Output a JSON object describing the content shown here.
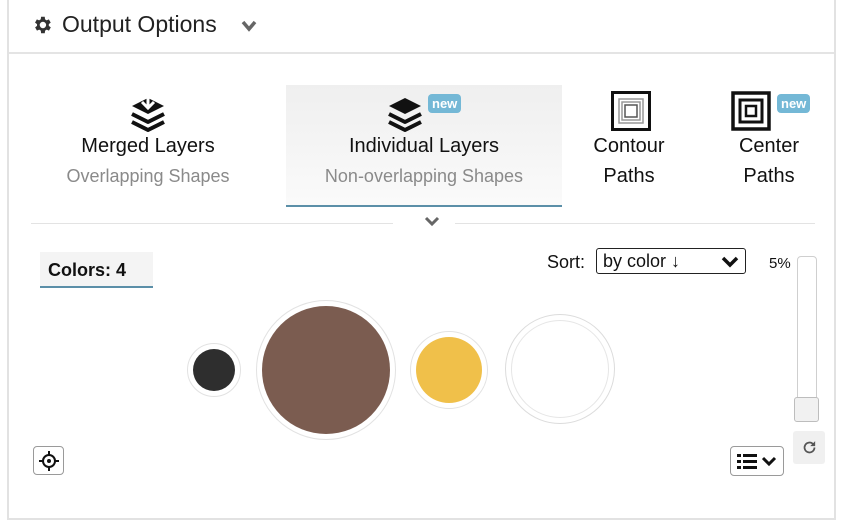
{
  "header": {
    "title": "Output Options",
    "icon": "gear-icon",
    "toggle_icon": "chevron-down-icon"
  },
  "tabs": [
    {
      "id": "merged",
      "label": "Merged Layers",
      "subtitle": "Overlapping Shapes",
      "icon": "layers-download-icon",
      "active": false,
      "badge": ""
    },
    {
      "id": "individual",
      "label": "Individual Layers",
      "subtitle": "Non-overlapping Shapes",
      "icon": "layers-icon",
      "active": true,
      "badge": "new"
    },
    {
      "id": "contour",
      "label_line1": "Contour",
      "label_line2": "Paths",
      "icon": "contour-paths-icon",
      "active": false,
      "badge": ""
    },
    {
      "id": "center",
      "label_line1": "Center",
      "label_line2": "Paths",
      "icon": "center-paths-icon",
      "active": false,
      "badge": "new"
    }
  ],
  "colors": {
    "label": "Colors: 4",
    "sort_label": "Sort:",
    "sort_value": "by color ↓",
    "swatches": [
      {
        "name": "dark",
        "hex": "#2e2e2e"
      },
      {
        "name": "brown",
        "hex": "#7b5c50"
      },
      {
        "name": "yellow",
        "hex": "#f0c04a"
      },
      {
        "name": "white",
        "hex": "#ffffff"
      }
    ]
  },
  "slider": {
    "value_label": "5%",
    "value": 0.05
  },
  "accent": "#5b8fa8",
  "badge_color": "#74b8d6"
}
